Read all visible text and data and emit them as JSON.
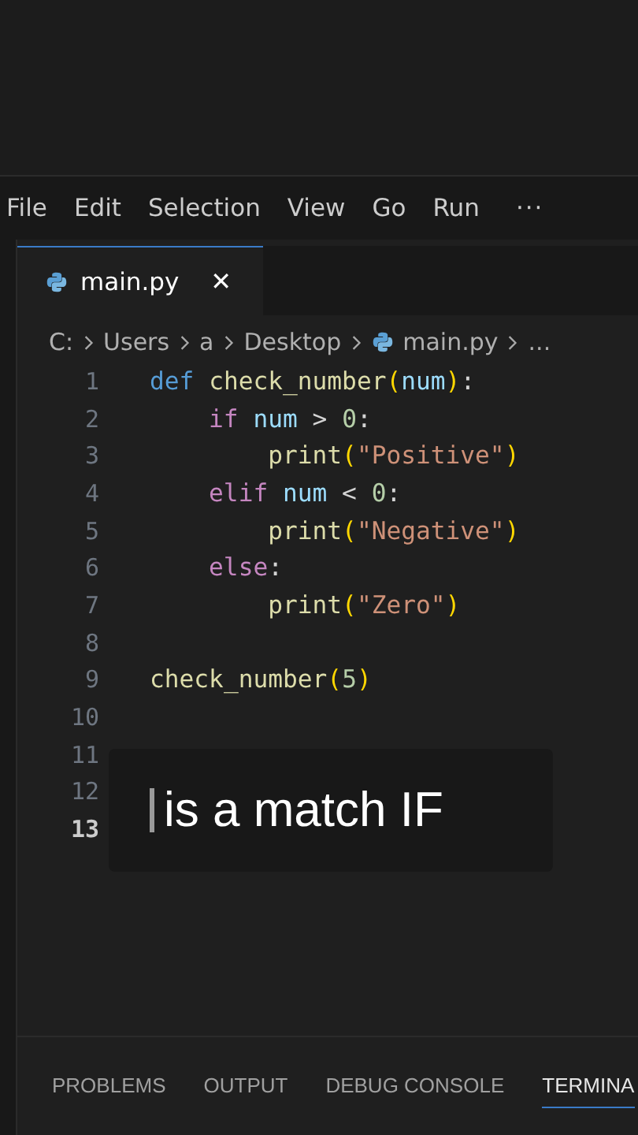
{
  "menu_bar": {
    "items": [
      "File",
      "Edit",
      "Selection",
      "View",
      "Go",
      "Run"
    ],
    "more": "···"
  },
  "tabs": [
    {
      "label": "main.py",
      "selected": true,
      "close": "✕"
    }
  ],
  "breadcrumb": {
    "parts": [
      "C:",
      "Users",
      "a",
      "Desktop"
    ],
    "file": "main.py",
    "more": "..."
  },
  "editor": {
    "lines": [
      {
        "number": "1",
        "current": false,
        "tokens": [
          {
            "kind": "keyword",
            "text": "def "
          },
          {
            "kind": "function",
            "text": "check_number"
          },
          {
            "kind": "paren",
            "text": "("
          },
          {
            "kind": "variable",
            "text": "num"
          },
          {
            "kind": "paren",
            "text": ")"
          },
          {
            "kind": "plain",
            "text": ":"
          }
        ],
        "children": [
          {
            "number": "2",
            "current": false,
            "tokens": [
              {
                "kind": "control",
                "text": "if "
              },
              {
                "kind": "variable",
                "text": "num"
              },
              {
                "kind": "plain",
                "text": " > "
              },
              {
                "kind": "number",
                "text": "0"
              },
              {
                "kind": "plain",
                "text": ":"
              }
            ],
            "children": [
              {
                "number": "3",
                "current": false,
                "tokens": [
                  {
                    "kind": "function",
                    "text": "print"
                  },
                  {
                    "kind": "paren",
                    "text": "("
                  },
                  {
                    "kind": "string",
                    "text": "\"Positive\""
                  },
                  {
                    "kind": "paren",
                    "text": ")"
                  }
                ]
              }
            ]
          },
          {
            "number": "4",
            "current": false,
            "tokens": [
              {
                "kind": "control",
                "text": "elif "
              },
              {
                "kind": "variable",
                "text": "num"
              },
              {
                "kind": "plain",
                "text": " < "
              },
              {
                "kind": "number",
                "text": "0"
              },
              {
                "kind": "plain",
                "text": ":"
              }
            ],
            "children": [
              {
                "number": "5",
                "current": false,
                "tokens": [
                  {
                    "kind": "function",
                    "text": "print"
                  },
                  {
                    "kind": "paren",
                    "text": "("
                  },
                  {
                    "kind": "string",
                    "text": "\"Negative\""
                  },
                  {
                    "kind": "paren",
                    "text": ")"
                  }
                ]
              }
            ]
          },
          {
            "number": "6",
            "current": false,
            "tokens": [
              {
                "kind": "control",
                "text": "else"
              },
              {
                "kind": "plain",
                "text": ":"
              }
            ],
            "children": [
              {
                "number": "7",
                "current": false,
                "tokens": [
                  {
                    "kind": "function",
                    "text": "print"
                  },
                  {
                    "kind": "paren",
                    "text": "("
                  },
                  {
                    "kind": "string",
                    "text": "\"Zero\""
                  },
                  {
                    "kind": "paren",
                    "text": ")"
                  }
                ]
              }
            ]
          },
          {
            "number": "8",
            "current": false
          }
        ]
      },
      {
        "number": "9",
        "current": false,
        "tokens": [
          {
            "kind": "function",
            "text": "check_number"
          },
          {
            "kind": "paren",
            "text": "("
          },
          {
            "kind": "number",
            "text": "5"
          },
          {
            "kind": "paren",
            "text": ")"
          }
        ]
      },
      {
        "number": "10",
        "current": false
      },
      {
        "number": "11",
        "current": false
      },
      {
        "number": "12",
        "current": false
      },
      {
        "number": "13",
        "current": true
      }
    ]
  },
  "caption": {
    "text": "is a match IF"
  },
  "panel_tabs": [
    {
      "label": "PROBLEMS",
      "selected": false
    },
    {
      "label": "OUTPUT",
      "selected": false
    },
    {
      "label": "DEBUG CONSOLE",
      "selected": false
    },
    {
      "label": "TERMINA",
      "selected": true
    }
  ]
}
